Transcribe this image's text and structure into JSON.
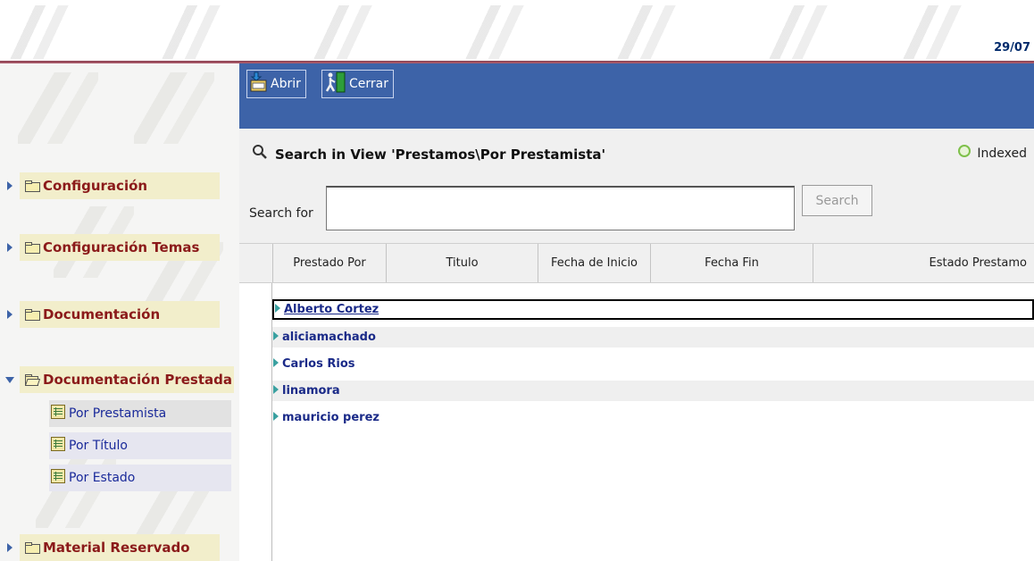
{
  "header": {
    "date": "29/07"
  },
  "sidebar": {
    "categories": [
      {
        "label": "Configuración"
      },
      {
        "label": "Configuración Temas"
      },
      {
        "label": "Documentación"
      },
      {
        "label": "Documentación Prestada"
      },
      {
        "label": "Material Reservado"
      }
    ],
    "subitems": [
      {
        "label": "Por Prestamista"
      },
      {
        "label": "Por Título"
      },
      {
        "label": "Por Estado"
      }
    ]
  },
  "toolbar": {
    "open_label": "Abrir",
    "close_label": "Cerrar"
  },
  "search": {
    "title": "Search in View 'Prestamos\\Por Prestamista'",
    "status": "Indexed",
    "for_label": "Search for",
    "value": "",
    "button_label": "Search"
  },
  "table": {
    "columns": [
      "Prestado Por",
      "Titulo",
      "Fecha de Inicio",
      "Fecha Fin",
      "Estado Prestamo"
    ],
    "rows": [
      "Alberto Cortez",
      "aliciamachado",
      "Carlos Rios",
      "linamora",
      "mauricio perez"
    ]
  },
  "colors": {
    "toolbar": "#3d63a8",
    "nav_label": "#8b1a1a",
    "nav_box": "#f2eecb",
    "row_text": "#1a2a88",
    "status_indicator": "#7ec04a"
  }
}
